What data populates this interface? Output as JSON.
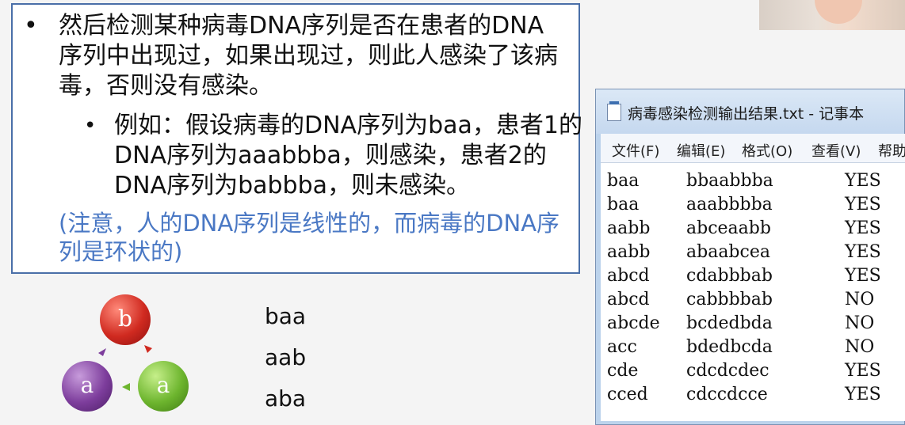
{
  "slide": {
    "bullet1": "然后检测某种病毒DNA序列是否在患者的DNA序列中出现过，如果出现过，则此人感染了该病毒，否则没有感染。",
    "bullet2": "例如：假设病毒的DNA序列为baa，患者1的DNA序列为aaabbba，则感染，患者2的DNA序列为babbba，则未感染。",
    "bullet_char": "•",
    "note": "(注意，人的DNA序列是线性的，而病毒的DNA序列是环状的)"
  },
  "circles": {
    "top": "b",
    "left": "a",
    "right": "a"
  },
  "rotations": [
    "baa",
    "aab",
    "aba"
  ],
  "notepad": {
    "title": "病毒感染检测输出结果.txt - 记事本",
    "menu": [
      "文件(F)",
      "编辑(E)",
      "格式(O)",
      "查看(V)",
      "帮助"
    ],
    "rows": [
      [
        "baa",
        "bbaabbba",
        "YES"
      ],
      [
        "baa",
        "aaabbbba",
        "YES"
      ],
      [
        "aabb",
        "abceaabb",
        "YES"
      ],
      [
        "aabb",
        "abaabcea",
        "YES"
      ],
      [
        "abcd",
        "cdabbbab",
        "YES"
      ],
      [
        "abcd",
        "cabbbbab",
        "NO"
      ],
      [
        "abcde",
        "bcdedbda",
        "NO"
      ],
      [
        "acc",
        "bdedbcda",
        "NO"
      ],
      [
        "cde",
        "cdcdcdec",
        "YES"
      ],
      [
        "cced",
        "cdccdcce",
        "YES"
      ]
    ]
  },
  "colors": {
    "note": "#4a78c4",
    "border": "#4a6fa8",
    "red": "#d02a20",
    "purple": "#7d3d9c",
    "green": "#6db52e"
  }
}
